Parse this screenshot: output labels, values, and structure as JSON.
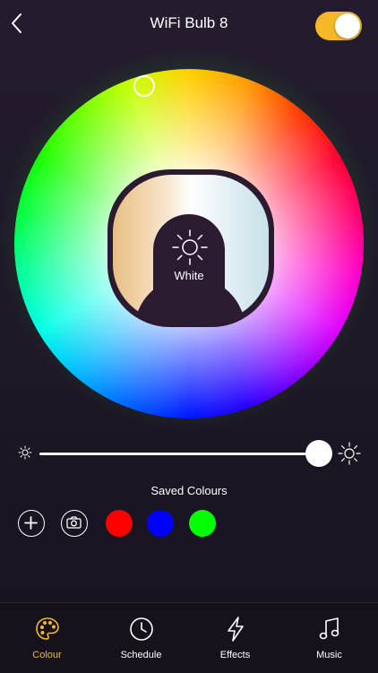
{
  "header": {
    "title": "WiFi Bulb 8",
    "back_icon": "chevron-left-icon",
    "power_on": true,
    "accent": "#f5b928"
  },
  "color_wheel": {
    "selector_icon": "ring-cursor",
    "glow_color": "#22c922"
  },
  "white_mode": {
    "label": "White",
    "icon": "sun-icon",
    "warm_color": "#e9be84",
    "cool_color": "#c7e1ea"
  },
  "brightness": {
    "low_icon": "sun-small-icon",
    "high_icon": "sun-large-icon",
    "level": 1.0
  },
  "saved_colours": {
    "title": "Saved Colours",
    "add_icon": "plus-icon",
    "camera_icon": "camera-icon",
    "swatches": [
      "#ff0000",
      "#0000ff",
      "#00ff00"
    ]
  },
  "tabs": [
    {
      "label": "Colour",
      "icon": "palette-icon",
      "active": true
    },
    {
      "label": "Schedule",
      "icon": "clock-icon",
      "active": false
    },
    {
      "label": "Effects",
      "icon": "lightning-icon",
      "active": false
    },
    {
      "label": "Music",
      "icon": "music-note-icon",
      "active": false
    }
  ]
}
